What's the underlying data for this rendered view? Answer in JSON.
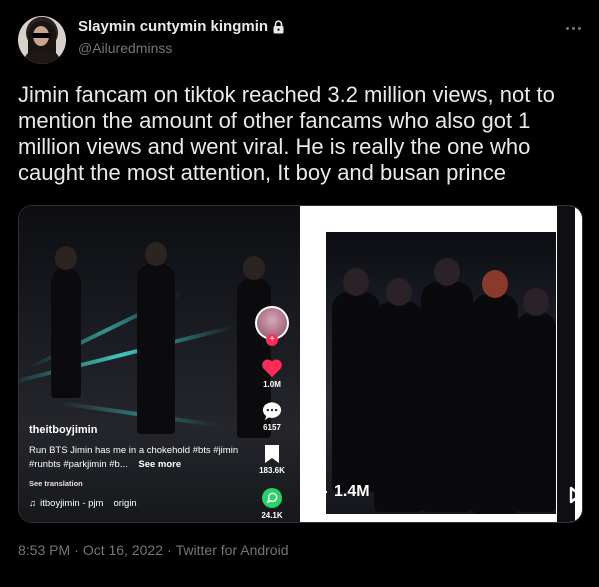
{
  "author": {
    "display_name": "Slaymin cuntymin kingmin",
    "handle": "@Ailuredminss",
    "avatar_icon": "user-avatar",
    "protected_icon": "lock-icon"
  },
  "menu": {
    "icon": "more-horizontal-icon"
  },
  "tweet": {
    "text": "Jimin fancam on tiktok reached 3.2  million views, not to mention the amount of other fancams who also got 1 million views and went viral. He is really the one who caught the most attention, It boy and  busan prince"
  },
  "media_left": {
    "username": "theitboyjimin",
    "caption": "Run BTS Jimin has me in a chokehold #bts #jimin #runbts #parkjimin #b...",
    "see_more": "See more",
    "see_translation": "See translation",
    "sound": "itboyjimin - pjm",
    "sound_suffix": "origin",
    "likes": "1.0M",
    "comments": "6157",
    "saves": "183.6K",
    "shares": "24.1K"
  },
  "media_right": {
    "views": "1.4M"
  },
  "meta": {
    "time": "8:53 PM",
    "separator": "·",
    "date": "Oct 16, 2022",
    "source": "Twitter for Android"
  },
  "colors": {
    "background": "#000000",
    "text": "#e7e9ea",
    "muted": "#71767b",
    "tiktok_red": "#fe2c55",
    "whatsapp_green": "#25d366"
  }
}
